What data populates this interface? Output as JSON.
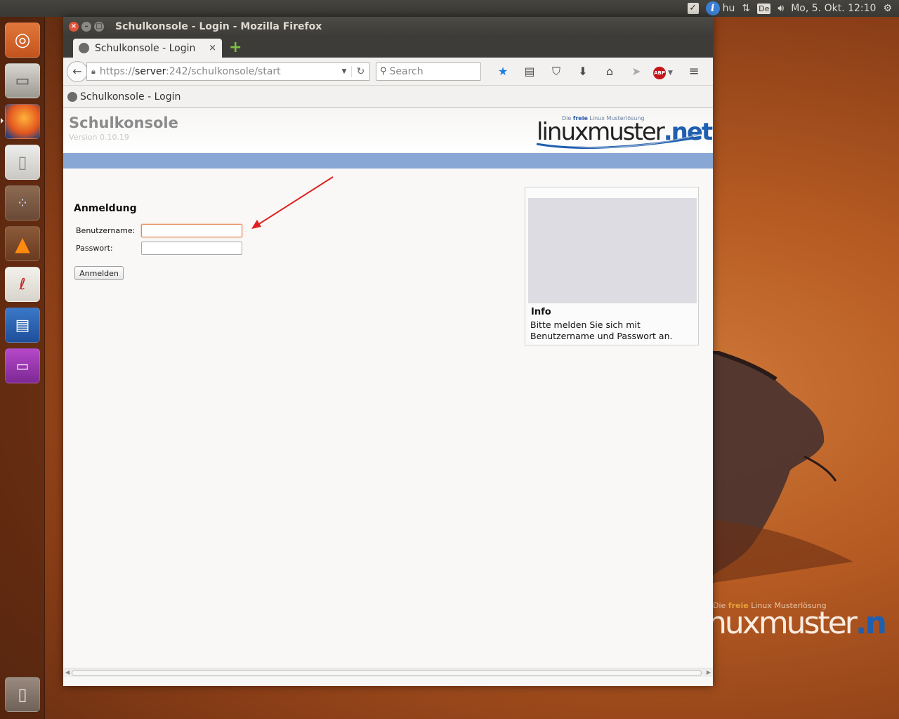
{
  "top_panel": {
    "keyboard_layout": "hu",
    "keyboard_indicator": "De",
    "clock": "Mo,  5. Okt. 12:10"
  },
  "launcher": {
    "icons": [
      "ubuntu-dash",
      "files",
      "firefox",
      "text-editor",
      "graph-app",
      "vlc",
      "pdf-viewer",
      "libreoffice-writer",
      "screen-app",
      "trash"
    ]
  },
  "browser": {
    "window_title": "Schulkonsole - Login - Mozilla Firefox",
    "tab": {
      "label": "Schulkonsole - Login",
      "close": "×",
      "new_tab": "+"
    },
    "url": {
      "scheme": "https://",
      "host": "server",
      "rest": ":242/schulkonsole/start"
    },
    "search_placeholder": "Search",
    "bookmark": "Schulkonsole - Login"
  },
  "page": {
    "app_title": "Schulkonsole",
    "app_version": "Version 0.10.19",
    "logo": {
      "tagline_prefix": "Die ",
      "tagline_free": "freie",
      "tagline_rest": " Linux Musterlösung",
      "main": "linuxmuster",
      "dot_net": ".net"
    },
    "login": {
      "heading": "Anmeldung",
      "username_label": "Benutzername:",
      "username_value": "",
      "password_label": "Passwort:",
      "password_value": "",
      "submit_label": "Anmelden"
    },
    "info": {
      "title": "Info",
      "text": "Bitte melden Sie sich mit Benutzername und Passwort an."
    }
  },
  "wallpaper_logo": {
    "tagline_prefix": "Die ",
    "tagline_free": "freie",
    "tagline_rest": " Linux Musterlösung",
    "main": "nuxmuster",
    "dot": ".n"
  },
  "colors": {
    "accent_blue_bar": "#89a7d4",
    "focus_border": "#e08a56",
    "arrow": "#e02020"
  }
}
